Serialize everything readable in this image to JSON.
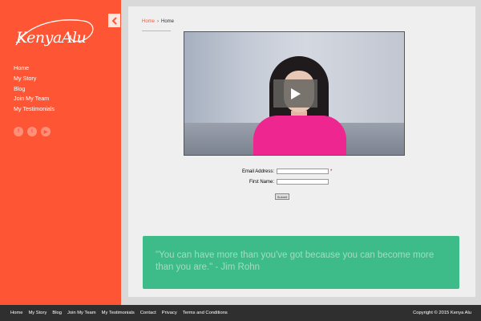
{
  "sidebar": {
    "logo_text": "KenyaAlu",
    "nav": [
      "Home",
      "My Story",
      "Blog",
      "Join My Team",
      "My Testimonials"
    ],
    "social_icons": [
      "facebook-icon",
      "twitter-icon",
      "youtube-icon"
    ],
    "accent_color": "#fe5534"
  },
  "breadcrumb": {
    "home": "Home",
    "current": "Home"
  },
  "form": {
    "email_label": "Email Address:",
    "email_value": "",
    "first_name_label": "First Name:",
    "first_name_value": "",
    "required_marker": "*",
    "submit_label": "Submit"
  },
  "quote": {
    "text": "\"You can have more than you've got because you can become more than you are.\" - Jim Rohn",
    "background_color": "#3dbb88"
  },
  "footer": {
    "links": [
      "Home",
      "My Story",
      "Blog",
      "Join My Team",
      "My Testimonials",
      "Contact",
      "Privacy",
      "Terms and Conditions"
    ],
    "copyright": "Copyright © 2015 Kenya Alu"
  }
}
